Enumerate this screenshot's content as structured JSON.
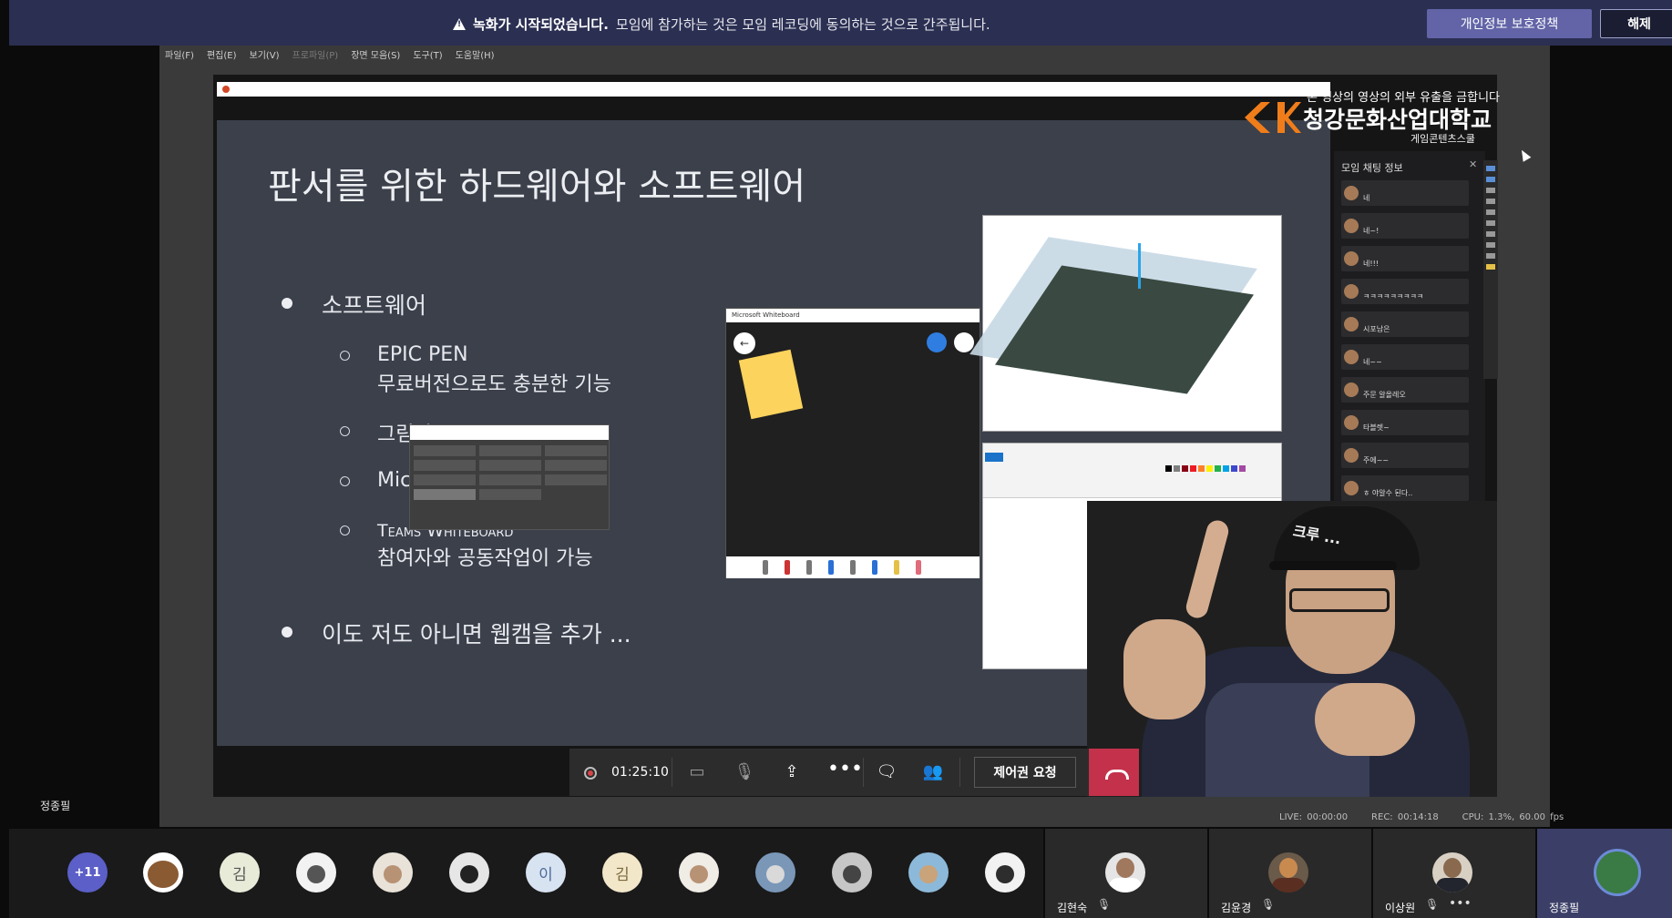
{
  "banner": {
    "headline": "녹화가 시작되었습니다.",
    "message": "모임에 참가하는 것은 모임 레코딩에 동의하는 것으로 간주됩니다.",
    "privacy_button": "개인정보 보호정책",
    "dismiss_button": "해제"
  },
  "shared_menu": [
    "파일(F)",
    "편집(E)",
    "보기(V)",
    "프로파일(P)",
    "장면 모음(S)",
    "도구(T)",
    "도움말(H)"
  ],
  "slide": {
    "title": "판서를 위한 하드웨어와 소프트웨어",
    "bullet_software": "소프트웨어",
    "sub1_line1": "EPIC PEN",
    "sub1_line2": "무료버전으로도 충분한 기능",
    "sub2": "그림판",
    "sub3": "Mic",
    "sub4_line1": "Teams Whiteboard",
    "sub4_line2": "참여자와 공동작업이 가능",
    "bullet_webcam": "이도 저도 아니면 웹캠을 추가 ..."
  },
  "college": {
    "name": "청강문화산업대학교",
    "department": "게임콘텐츠스쿨",
    "watermark": "본 영상의 영상의 외부 유출을 금합니다"
  },
  "chat": {
    "title": "모임 채팅 정보",
    "messages": [
      "네",
      "네~!",
      "네!!!",
      "ㅋㅋㅋㅋㅋㅋㅋㅋㅋ",
      "시포남은",
      "네~~",
      "주문 알올레오",
      "타블렛~",
      "주에~~",
      "ㅎ 야알수 된다.."
    ]
  },
  "whiteboard": {
    "title": "Microsoft Whiteboard"
  },
  "controls": {
    "timer": "01:25:10",
    "request_control": "제어권 요청"
  },
  "stats": {
    "live": "LIVE: 00:00:00",
    "rec": "REC: 00:14:18",
    "cpu": "CPU: 1.3%, 60.00 fps"
  },
  "presenter_label": "정종필",
  "participants": {
    "overflow": "+11",
    "initial_a": "김",
    "initial_b": "이",
    "initial_c": "김"
  },
  "tiles": [
    {
      "name": "김현숙"
    },
    {
      "name": "김윤경"
    },
    {
      "name": "이상원"
    },
    {
      "name": "정종필"
    }
  ],
  "presenter_cap_text": "크루 ...",
  "colors": {
    "banner_bg": "#2b2f52",
    "accent": "#6264a7",
    "hangup": "#c4314b",
    "slide_bg": "#3b404b"
  }
}
